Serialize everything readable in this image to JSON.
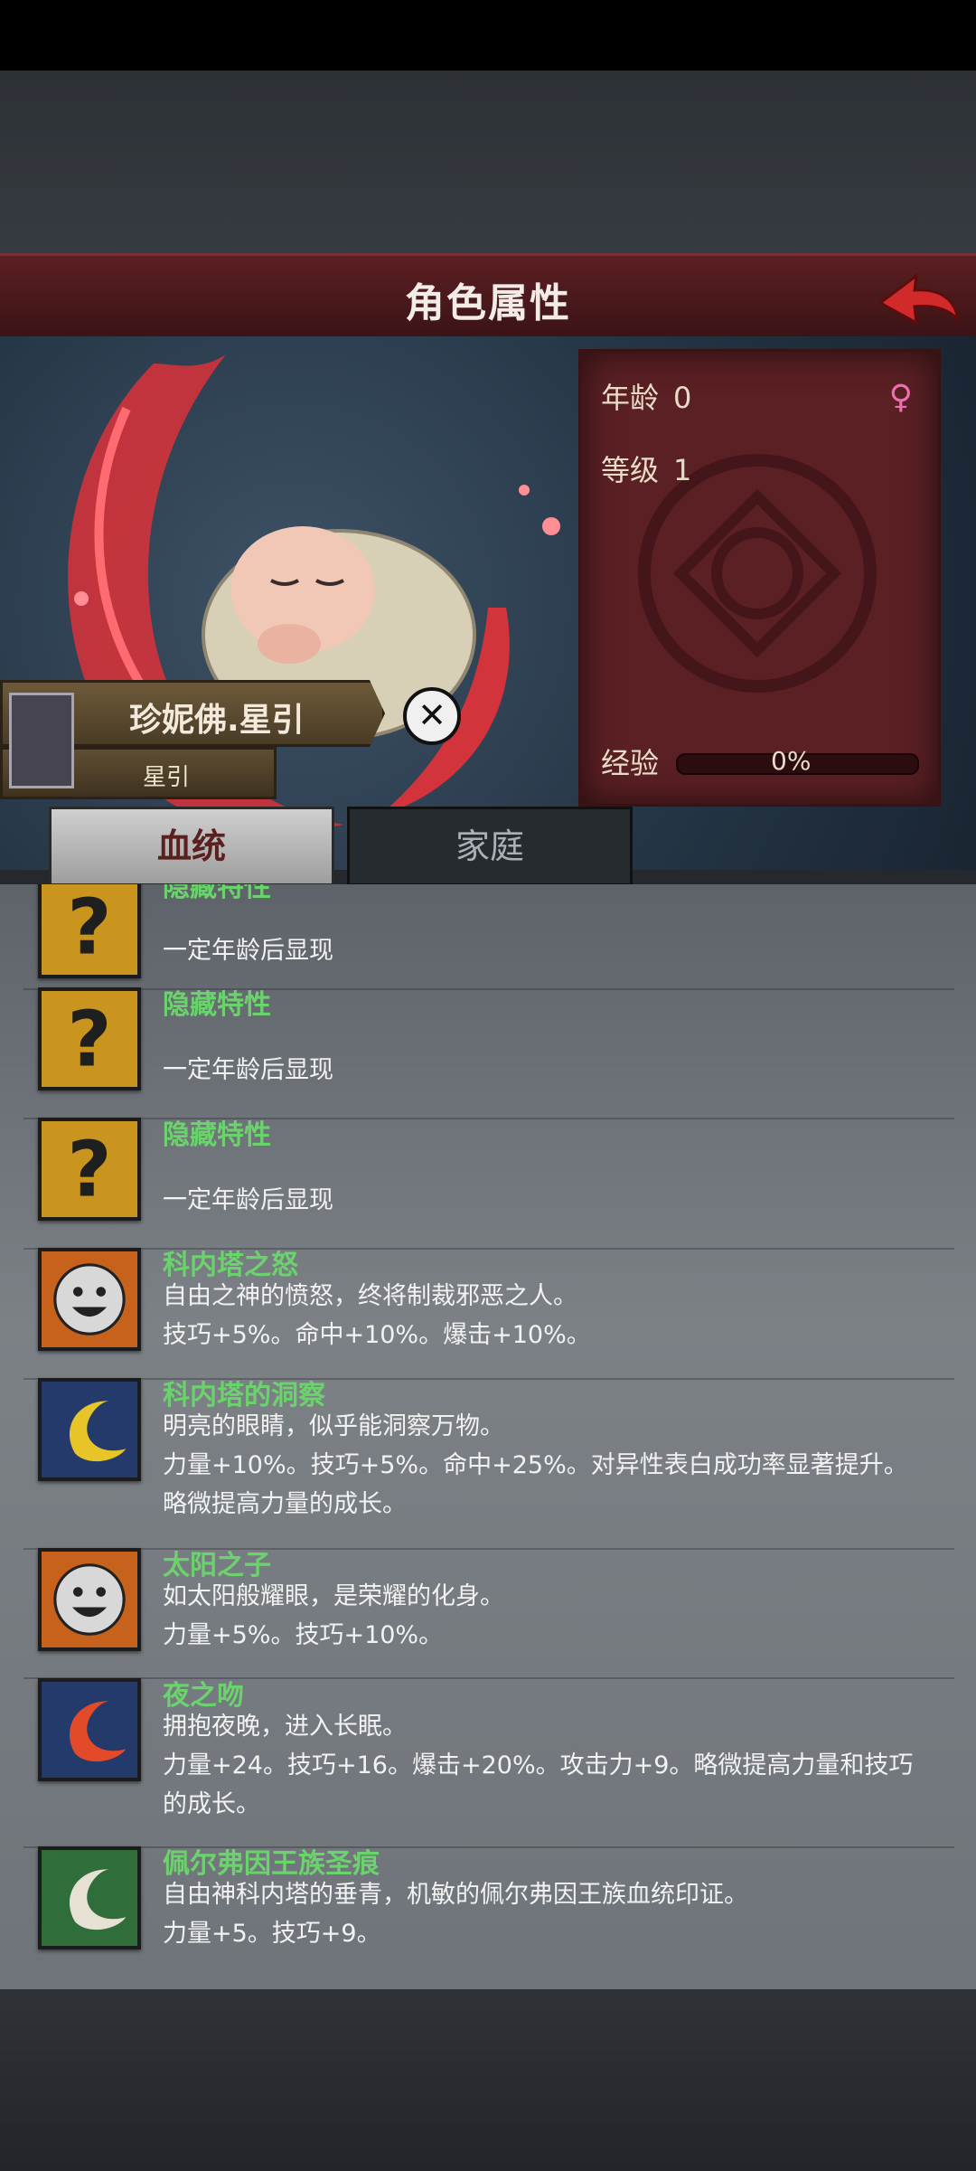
{
  "header": {
    "title": "角色属性"
  },
  "character": {
    "name": "珍妮佛.星引",
    "house": "星引",
    "age_label": "年龄",
    "age_value": "0",
    "level_label": "等级",
    "level_value": "1",
    "exp_label": "经验",
    "exp_value": "0%",
    "exp_progress": 0
  },
  "tabs": [
    {
      "label": "血统",
      "active": true
    },
    {
      "label": "家庭",
      "active": false
    }
  ],
  "traits": [
    {
      "name": "隐藏特性",
      "desc": [
        "一定年龄后显现"
      ],
      "icon": "question-icon"
    },
    {
      "name": "隐藏特性",
      "desc": [
        "一定年龄后显现"
      ],
      "icon": "question-icon"
    },
    {
      "name": "隐藏特性",
      "desc": [
        "一定年龄后显现"
      ],
      "icon": "question-icon"
    },
    {
      "name": "科内塔之怒",
      "desc": [
        "自由之神的愤怒，终将制裁邪恶之人。",
        "技巧+5%。命中+10%。爆击+10%。"
      ],
      "icon": "smiley-face-icon"
    },
    {
      "name": "科内塔的洞察",
      "desc": [
        "明亮的眼睛，似乎能洞察万物。",
        "力量+10%。技巧+5%。命中+25%。对异性表白成功率显著提升。",
        "略微提高力量的成长。"
      ],
      "icon": "yellow-crescent-icon"
    },
    {
      "name": "太阳之子",
      "desc": [
        "如太阳般耀眼，是荣耀的化身。",
        "力量+5%。技巧+10%。"
      ],
      "icon": "smiley-face-icon"
    },
    {
      "name": "夜之吻",
      "desc": [
        "拥抱夜晚，进入长眠。",
        "力量+24。技巧+16。爆击+20%。攻击力+9。略微提高力量和技巧",
        "的成长。"
      ],
      "icon": "red-crescent-icon"
    },
    {
      "name": "佩尔弗因王族圣痕",
      "desc": [
        "自由神科内塔的垂青，机敏的佩尔弗因王族血统印证。",
        "力量+5。技巧+9。"
      ],
      "icon": "white-crescent-icon"
    }
  ]
}
